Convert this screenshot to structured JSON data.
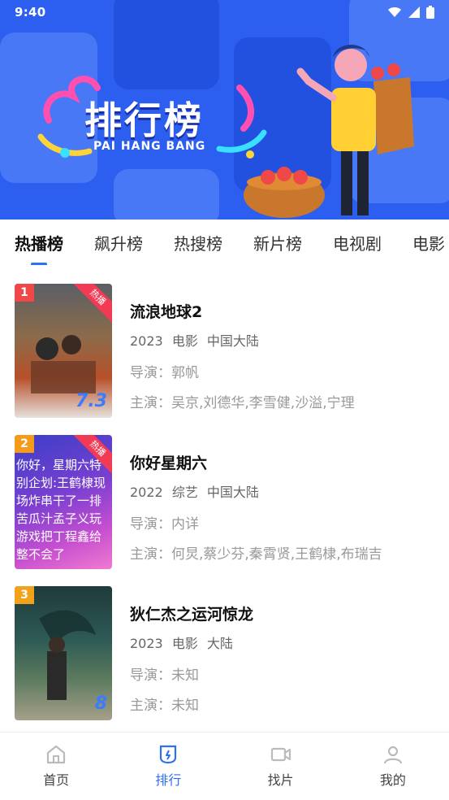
{
  "status": {
    "time": "9:40"
  },
  "banner": {
    "title": "排行榜",
    "subtitle": "PAI HANG BANG"
  },
  "tabs": [
    {
      "label": "热播榜",
      "active": true
    },
    {
      "label": "飙升榜",
      "active": false
    },
    {
      "label": "热搜榜",
      "active": false
    },
    {
      "label": "新片榜",
      "active": false
    },
    {
      "label": "电视剧",
      "active": false
    },
    {
      "label": "电影",
      "active": false
    }
  ],
  "items": [
    {
      "rank": "1",
      "hot": "热播",
      "score": "7.3",
      "title": "流浪地球2",
      "year": "2023",
      "type": "电影",
      "region": "中国大陆",
      "director": "导演：郭帆",
      "cast": "主演：吴京,刘德华,李雪健,沙溢,宁理",
      "poster_text": ""
    },
    {
      "rank": "2",
      "hot": "热播",
      "score": "",
      "title": "你好星期六",
      "year": "2022",
      "type": "综艺",
      "region": "中国大陆",
      "director": "导演：内详",
      "cast": "主演：何炅,蔡少芬,秦霄贤,王鹤棣,布瑞吉",
      "poster_text": "你好，星期六特别企划:王鹤棣现场炸串干了一排苦瓜汁孟子义玩游戏把丁程鑫给整不会了"
    },
    {
      "rank": "3",
      "hot": "",
      "score": "8",
      "title": "狄仁杰之运河惊龙",
      "year": "2023",
      "type": "电影",
      "region": "大陆",
      "director": "导演：未知",
      "cast": "主演：未知",
      "poster_text": ""
    }
  ],
  "nav": [
    {
      "label": "首页",
      "icon": "home-icon",
      "active": false
    },
    {
      "label": "排行",
      "icon": "ranking-icon",
      "active": true
    },
    {
      "label": "找片",
      "icon": "video-camera-icon",
      "active": false
    },
    {
      "label": "我的",
      "icon": "user-icon",
      "active": false
    }
  ],
  "colors": {
    "accent": "#2f6ff2",
    "banner": "#2c5ff0",
    "hot_badge": "#f33a54"
  }
}
